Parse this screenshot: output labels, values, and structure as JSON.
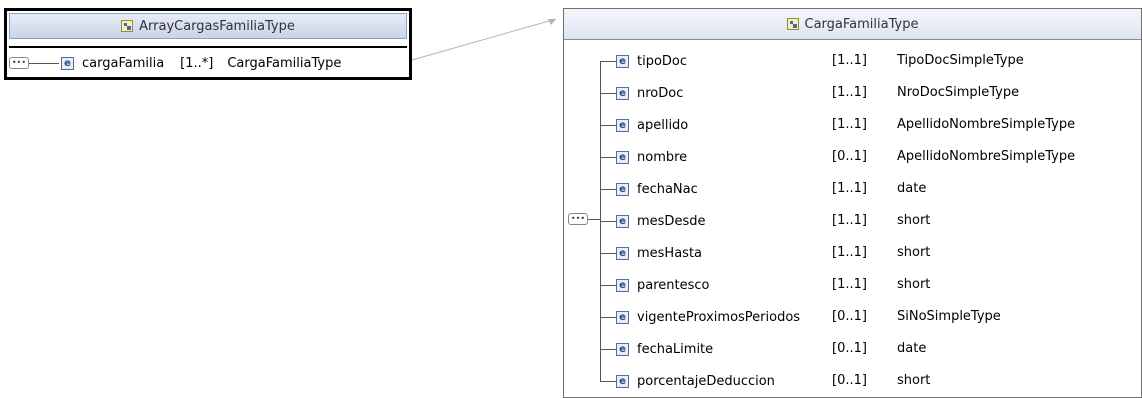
{
  "left_type": {
    "title": "ArrayCargasFamiliaType",
    "element": {
      "name": "cargaFamilia",
      "cardinality": "[1..*]",
      "type": "CargaFamiliaType"
    }
  },
  "right_type": {
    "title": "CargaFamiliaType",
    "elements": [
      {
        "name": "tipoDoc",
        "cardinality": "[1..1]",
        "type": "TipoDocSimpleType"
      },
      {
        "name": "nroDoc",
        "cardinality": "[1..1]",
        "type": "NroDocSimpleType"
      },
      {
        "name": "apellido",
        "cardinality": "[1..1]",
        "type": "ApellidoNombreSimpleType"
      },
      {
        "name": "nombre",
        "cardinality": "[0..1]",
        "type": "ApellidoNombreSimpleType"
      },
      {
        "name": "fechaNac",
        "cardinality": "[1..1]",
        "type": "date"
      },
      {
        "name": "mesDesde",
        "cardinality": "[1..1]",
        "type": "short"
      },
      {
        "name": "mesHasta",
        "cardinality": "[1..1]",
        "type": "short"
      },
      {
        "name": "parentesco",
        "cardinality": "[1..1]",
        "type": "short"
      },
      {
        "name": "vigenteProximosPeriodos",
        "cardinality": "[0..1]",
        "type": "SiNoSimpleType"
      },
      {
        "name": "fechaLimite",
        "cardinality": "[0..1]",
        "type": "date"
      },
      {
        "name": "porcentajeDeduccion",
        "cardinality": "[0..1]",
        "type": "short"
      }
    ]
  },
  "icons": {
    "complex_type": "complex-type-icon",
    "element": "element-icon",
    "sequence": "sequence-icon"
  },
  "colors": {
    "header_light": "#dfe6f1",
    "icon_border": "#4f6f99"
  }
}
